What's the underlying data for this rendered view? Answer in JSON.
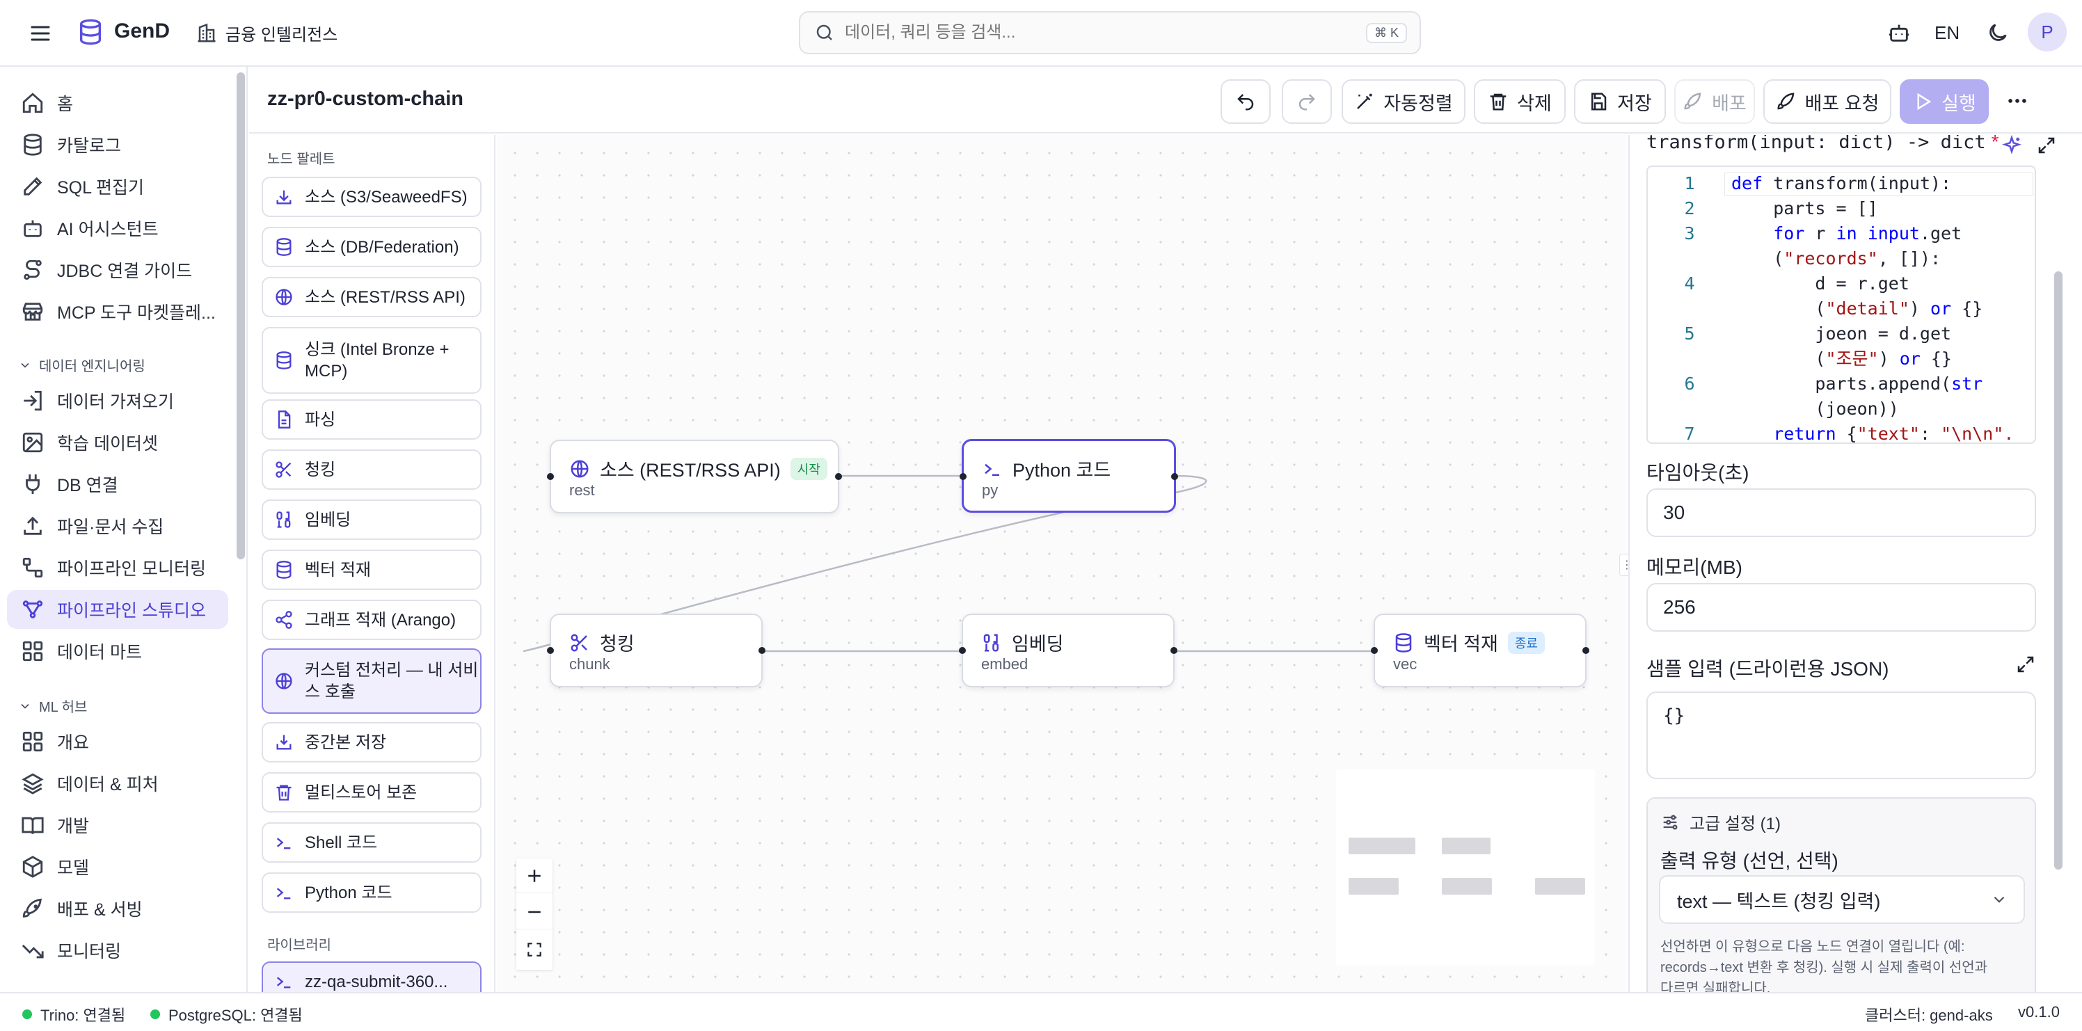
{
  "app": {
    "name": "GenD",
    "workspace": "금융 인텔리전스"
  },
  "search": {
    "placeholder": "데이터, 쿼리 등을 검색...",
    "shortcut": "⌘ K"
  },
  "topbar": {
    "language": "EN",
    "avatar": "P"
  },
  "sidebar": {
    "items": [
      {
        "label": "홈",
        "icon": "home-icon"
      },
      {
        "label": "카탈로그",
        "icon": "database-icon"
      },
      {
        "label": "SQL 편집기",
        "icon": "edit-icon"
      },
      {
        "label": "AI 어시스턴트",
        "icon": "bot-icon"
      },
      {
        "label": "JDBC 연결 가이드",
        "icon": "plug-route-icon"
      },
      {
        "label": "MCP 도구 마켓플레...",
        "icon": "store-icon"
      }
    ],
    "section_data_eng": "데이터 엔지니어링",
    "data_eng_items": [
      {
        "label": "데이터 가져오기",
        "icon": "import-icon"
      },
      {
        "label": "학습 데이터셋",
        "icon": "image-icon"
      },
      {
        "label": "DB 연결",
        "icon": "plug-icon"
      },
      {
        "label": "파일·문서 수집",
        "icon": "upload-icon"
      },
      {
        "label": "파이프라인 모니터링",
        "icon": "pipeline-icon"
      },
      {
        "label": "파이프라인 스튜디오",
        "icon": "workflow-icon",
        "active": true
      },
      {
        "label": "데이터 마트",
        "icon": "grid-icon"
      }
    ],
    "section_ml": "ML 허브",
    "ml_items": [
      {
        "label": "개요",
        "icon": "grid-icon"
      },
      {
        "label": "데이터 & 피처",
        "icon": "layers-icon"
      },
      {
        "label": "개발",
        "icon": "book-icon"
      },
      {
        "label": "모델",
        "icon": "box-icon"
      },
      {
        "label": "배포 & 서빙",
        "icon": "rocket-icon"
      },
      {
        "label": "모니터링",
        "icon": "trend-icon"
      }
    ]
  },
  "editor": {
    "title": "zz-pr0-custom-chain",
    "toolbar": {
      "auto_layout": "자동정렬",
      "delete": "삭제",
      "save": "저장",
      "deploy": "배포",
      "deploy_request": "배포 요청",
      "run": "실행"
    }
  },
  "palette": {
    "heading": "노드 팔레트",
    "items": [
      {
        "label": "소스 (S3/SeaweedFS)",
        "icon": "download-icon"
      },
      {
        "label": "소스 (DB/Federation)",
        "icon": "database-icon"
      },
      {
        "label": "소스 (REST/RSS API)",
        "icon": "globe-icon"
      },
      {
        "label": "싱크 (Intel Bronze + MCP)",
        "icon": "database-icon"
      },
      {
        "label": "파싱",
        "icon": "file-icon"
      },
      {
        "label": "청킹",
        "icon": "scissors-icon"
      },
      {
        "label": "임베딩",
        "icon": "binary-icon"
      },
      {
        "label": "벡터 적재",
        "icon": "database-icon"
      },
      {
        "label": "그래프 적재 (Arango)",
        "icon": "share-icon"
      },
      {
        "label": "커스텀 전처리 — 내 서비스 호출",
        "icon": "globe-icon",
        "active": true
      },
      {
        "label": "중간본 저장",
        "icon": "save-down-icon"
      },
      {
        "label": "멀티스토어 보존",
        "icon": "trash-icon"
      },
      {
        "label": "Shell 코드",
        "icon": "terminal-icon"
      },
      {
        "label": "Python 코드",
        "icon": "terminal-icon"
      }
    ],
    "library_heading": "라이브러리",
    "library_items": [
      {
        "label": "zz-qa-submit-360...",
        "icon": "terminal-icon"
      }
    ]
  },
  "nodes": {
    "rest": {
      "title": "소스 (REST/RSS API)",
      "sub": "rest",
      "badge": "시작",
      "icon": "globe-icon"
    },
    "py": {
      "title": "Python 코드",
      "sub": "py",
      "icon": "terminal-icon"
    },
    "chunk": {
      "title": "청킹",
      "sub": "chunk",
      "icon": "scissors-icon"
    },
    "embed": {
      "title": "임베딩",
      "sub": "embed",
      "icon": "binary-icon"
    },
    "vec": {
      "title": "벡터 적재",
      "sub": "vec",
      "badge": "종료",
      "icon": "database-icon"
    }
  },
  "inspector": {
    "code_label": "transform(input: dict) -> dict",
    "required_mark": "*",
    "code_lines": [
      {
        "n": "1",
        "tokens": [
          [
            "kw",
            "def "
          ],
          [
            "fn",
            "transform"
          ],
          [
            "fn",
            "(input):"
          ]
        ]
      },
      {
        "n": "2",
        "tokens": [
          [
            "fn",
            "    parts = []"
          ]
        ]
      },
      {
        "n": "3",
        "tokens": [
          [
            "kw",
            "    for "
          ],
          [
            "fn",
            "r "
          ],
          [
            "kw",
            "in "
          ],
          [
            "kw",
            "input"
          ],
          [
            "fn",
            ".get"
          ]
        ]
      },
      {
        "n": "",
        "tokens": [
          [
            "fn",
            "    ("
          ],
          [
            "str",
            "\"records\""
          ],
          [
            "fn",
            ", []):"
          ]
        ]
      },
      {
        "n": "4",
        "tokens": [
          [
            "fn",
            "        d = r.get"
          ]
        ]
      },
      {
        "n": "",
        "tokens": [
          [
            "fn",
            "        ("
          ],
          [
            "str",
            "\"detail\""
          ],
          [
            "fn",
            ") "
          ],
          [
            "kw",
            "or "
          ],
          [
            "fn",
            "{}"
          ]
        ]
      },
      {
        "n": "5",
        "tokens": [
          [
            "fn",
            "        joeon = d.get"
          ]
        ]
      },
      {
        "n": "",
        "tokens": [
          [
            "fn",
            "        ("
          ],
          [
            "str",
            "\"조문\""
          ],
          [
            "fn",
            ") "
          ],
          [
            "kw",
            "or "
          ],
          [
            "fn",
            "{}"
          ]
        ]
      },
      {
        "n": "6",
        "tokens": [
          [
            "fn",
            "        parts.append("
          ],
          [
            "kw",
            "str"
          ]
        ]
      },
      {
        "n": "",
        "tokens": [
          [
            "fn",
            "        (joeon))"
          ]
        ]
      },
      {
        "n": "7",
        "tokens": [
          [
            "kw",
            "    return "
          ],
          [
            "fn",
            "{"
          ],
          [
            "str",
            "\"text\""
          ],
          [
            "fn",
            ": "
          ],
          [
            "str",
            "\"\\n\\n\"."
          ]
        ]
      }
    ],
    "timeout_label": "타임아웃(초)",
    "timeout_value": "30",
    "memory_label": "메모리(MB)",
    "memory_value": "256",
    "sample_label": "샘플 입력 (드라이런용 JSON)",
    "sample_value": "{}",
    "advanced_label": "고급 설정 (1)",
    "output_type_label": "출력 유형 (선언, 선택)",
    "output_type_value": "text — 텍스트 (청킹 입력)",
    "help_line1": "선언하면 이 유형으로 다음 노드 연결이 열립니다 (예:",
    "help_line2": "records→text 변환 후 청킹). 실행 시 실제 출력이 선언과",
    "help_line3": "다르면 실패합니다."
  },
  "status": {
    "trino": "Trino: 연결됨",
    "postgres": "PostgreSQL: 연결됨",
    "cluster": "클러스터: gend-aks",
    "version": "v0.1.0",
    "color_ok": "#22c55e"
  }
}
